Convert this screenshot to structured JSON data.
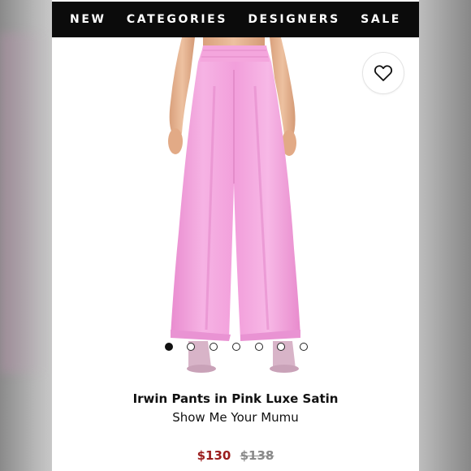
{
  "nav": {
    "items": [
      {
        "label": "NEW"
      },
      {
        "label": "CATEGORIES"
      },
      {
        "label": "DESIGNERS"
      },
      {
        "label": "SALE"
      }
    ]
  },
  "product": {
    "title": "Irwin Pants in Pink Luxe Satin",
    "brand": "Show Me Your Mumu",
    "price_sale": "$130",
    "price_original": "$138",
    "image_count": 7,
    "active_image": 1,
    "colors": {
      "garment": "#f2a3dc",
      "sale_price": "#9b1c1c",
      "nav_bg": "#0b0b0b"
    }
  },
  "icons": {
    "wishlist": "heart-outline-icon"
  }
}
